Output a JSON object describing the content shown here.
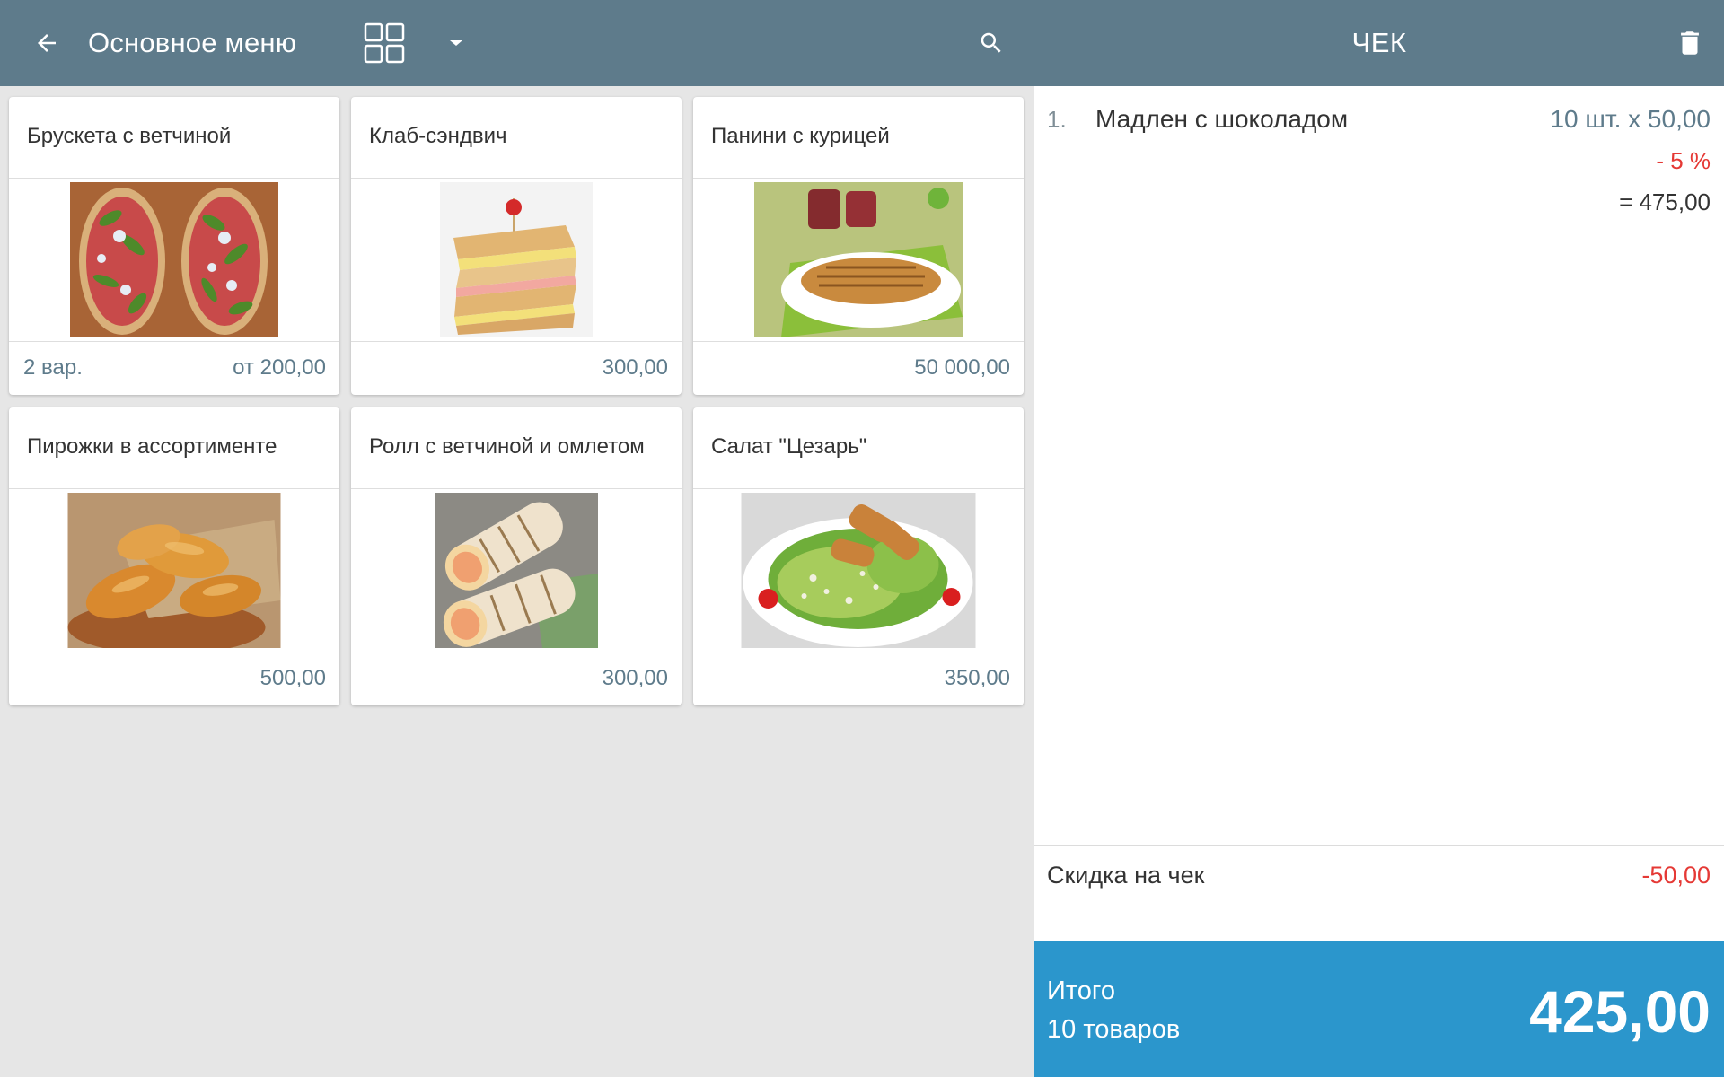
{
  "header": {
    "menu_title": "Основное меню",
    "receipt_title": "ЧЕК",
    "icons": [
      "arrow-back-icon",
      "grid-view-icon",
      "dropdown-arrow-icon",
      "search-icon",
      "trash-icon"
    ]
  },
  "products": [
    {
      "name": "Брускета с ветчиной",
      "variants": "2  вар.",
      "price": "от 200,00",
      "image": "bruschetta-photo"
    },
    {
      "name": "Клаб-сэндвич",
      "variants": "",
      "price": "300,00",
      "image": "club-sandwich-photo"
    },
    {
      "name": "Панини с курицей",
      "variants": "",
      "price": "50 000,00",
      "image": "panini-photo"
    },
    {
      "name": "Пирожки в ассортименте",
      "variants": "",
      "price": "500,00",
      "image": "pies-photo"
    },
    {
      "name": "Ролл с ветчиной и омлетом",
      "variants": "",
      "price": "300,00",
      "image": "roll-photo"
    },
    {
      "name": "Салат \"Цезарь\"",
      "variants": "",
      "price": "350,00",
      "image": "caesar-salad-photo"
    }
  ],
  "receipt": {
    "lines": [
      {
        "number": "1.",
        "name": "Мадлен с шоколадом",
        "qty_price": "10 шт. x 50,00",
        "discount": "- 5 %",
        "total": "= 475,00"
      }
    ],
    "check_discount_label": "Скидка на чек",
    "check_discount_value": "-50,00",
    "total_label": "Итого",
    "total_items": "10 товаров",
    "total_amount": "425,00"
  },
  "colors": {
    "header_bg": "#5e7b8b",
    "price_text": "#5e7b8b",
    "discount_text": "#e53935",
    "total_bar_bg": "#2b96cc",
    "grid_bg": "#e6e6e6"
  }
}
